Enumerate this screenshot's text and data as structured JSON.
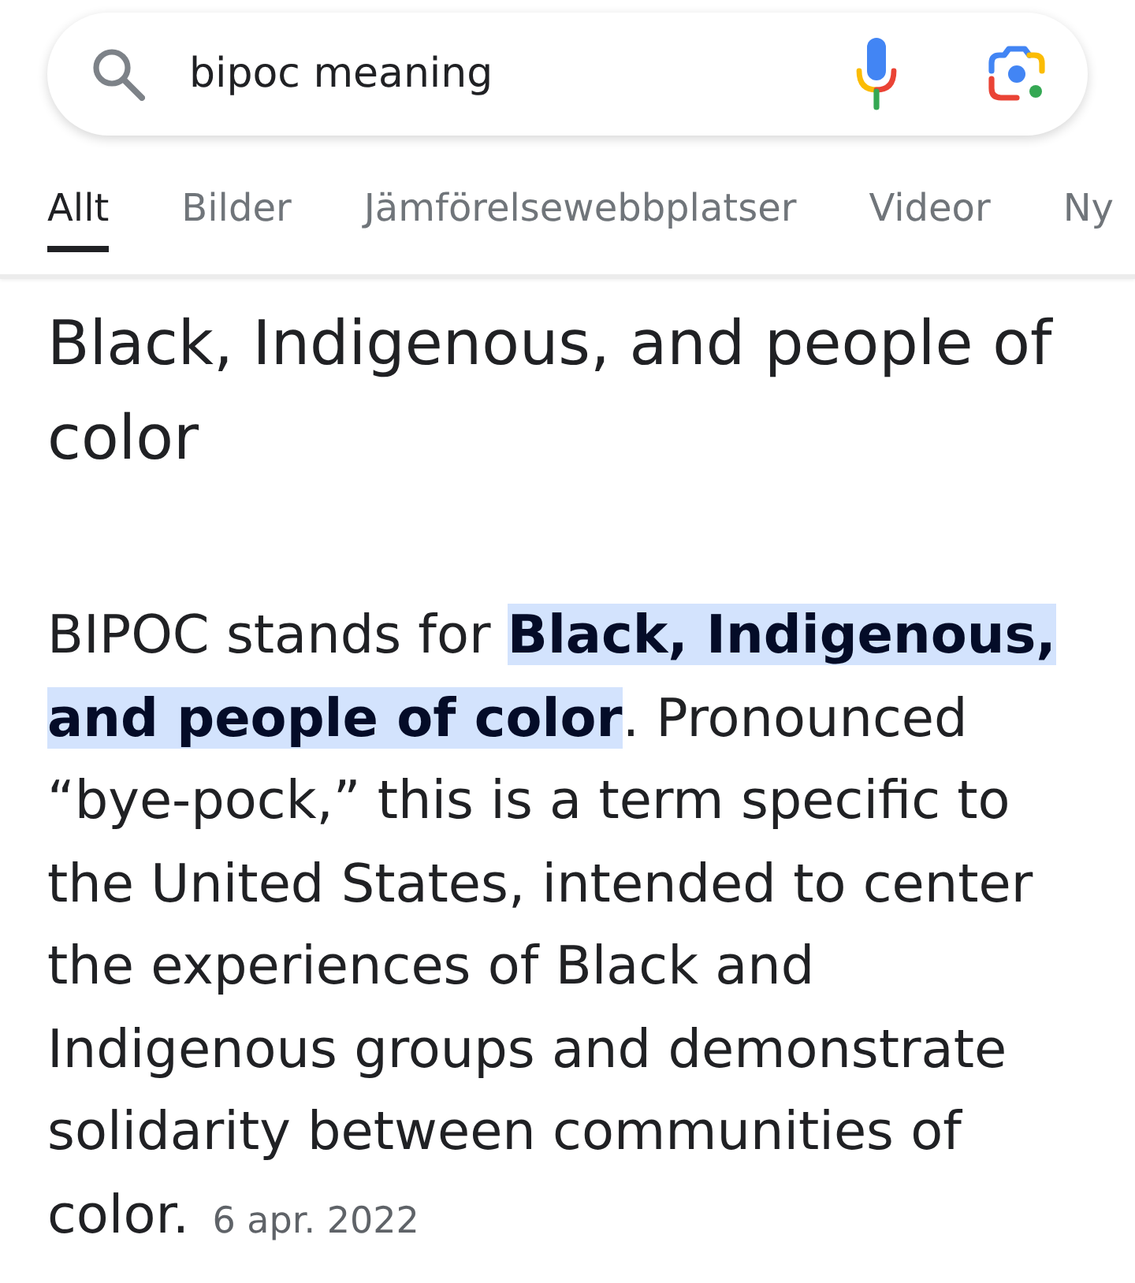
{
  "search": {
    "query": "bipoc meaning"
  },
  "tabs": [
    {
      "label": "Allt",
      "selected": true
    },
    {
      "label": "Bilder",
      "selected": false
    },
    {
      "label": "Jämförelsewebbplatser",
      "selected": false
    },
    {
      "label": "Videor",
      "selected": false
    },
    {
      "label": "Ny",
      "selected": false
    }
  ],
  "result": {
    "heading": "Black, Indigenous, and people of color",
    "snippet": "BIPOC stands for **Black, Indigenous, and people of color**. Pronounced “bye-pock,” this is a term specific to the United States, intended to center the experiences of Black and Indigenous groups and demonstrate solidarity between communities of color.",
    "date": "6 apr. 2022"
  }
}
